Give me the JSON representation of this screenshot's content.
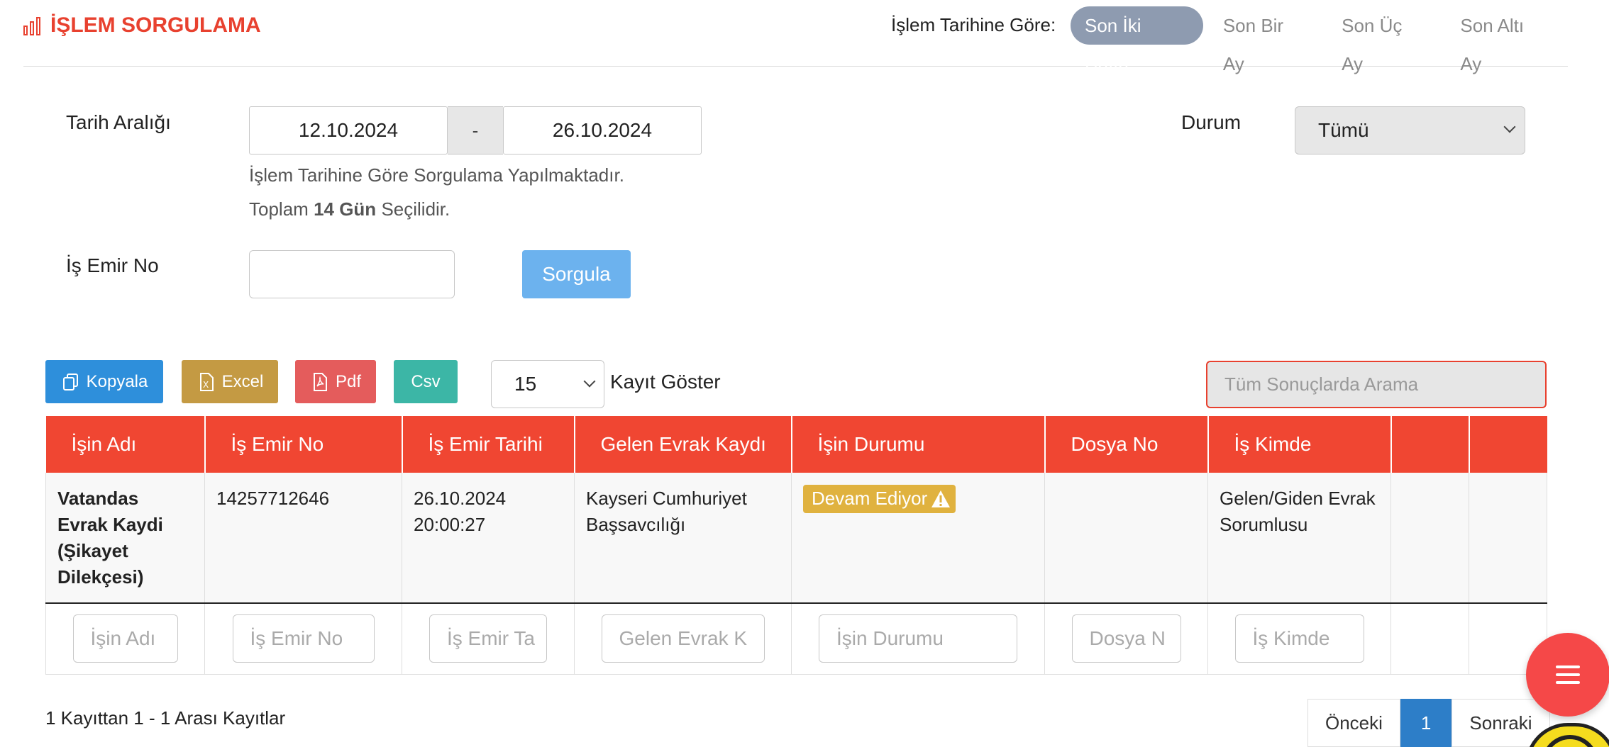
{
  "header": {
    "title": "İŞLEM SORGULAMA",
    "period_label": "İşlem Tarihine Göre:",
    "period_tabs": [
      {
        "label": "Son İki Hafta",
        "active": true
      },
      {
        "label": "Son Bir Ay",
        "active": false
      },
      {
        "label": "Son Üç Ay",
        "active": false
      },
      {
        "label": "Son Altı Ay",
        "active": false
      }
    ]
  },
  "form": {
    "date_range_label": "Tarih Aralığı",
    "date_from": "12.10.2024",
    "date_separator": "-",
    "date_to": "26.10.2024",
    "hint_line1": "İşlem Tarihine Göre Sorgulama Yapılmaktadır.",
    "hint_total_prefix": "Toplam",
    "hint_total_bold": "14 Gün",
    "hint_total_suffix": "Seçilidir.",
    "status_label": "Durum",
    "status_value": "Tümü",
    "order_no_label": "İş Emir No",
    "order_no_value": "",
    "query_button": "Sorgula"
  },
  "toolbar": {
    "copy": "Kopyala",
    "excel": "Excel",
    "pdf": "Pdf",
    "csv": "Csv",
    "page_length": "15",
    "page_length_label": "Kayıt Göster",
    "search_placeholder": "Tüm Sonuçlarda Arama",
    "colors": {
      "copy": "#2e8fdb",
      "excel": "#c49a43",
      "pdf": "#e45c5c",
      "csv": "#3cb6a6"
    }
  },
  "table": {
    "columns": [
      "İşin Adı",
      "İş Emir No",
      "İş Emir Tarihi",
      "Gelen Evrak Kaydı",
      "İşin Durumu",
      "Dosya No",
      "İş Kimde",
      "",
      ""
    ],
    "rows": [
      {
        "job_name": "Vatandas Evrak Kaydi (Şikayet Dilekçesi)",
        "order_no": "14257712646",
        "order_date": "26.10.2024 20:00:27",
        "incoming_record": "Kayseri Cumhuriyet Başsavcılığı",
        "status": "Devam Ediyor",
        "file_no": "",
        "assignee": "Gelen/Giden Evrak Sorumlusu"
      }
    ],
    "filters": [
      "İşin Adı",
      "İş Emir No",
      "İş Emir Ta",
      "Gelen Evrak K",
      "İşin Durumu",
      "Dosya N",
      "İş Kimde"
    ]
  },
  "footer": {
    "info": "1 Kayıttan 1 - 1 Arası Kayıtlar",
    "prev": "Önceki",
    "current_page": "1",
    "next": "Sonraki"
  },
  "colors": {
    "accent": "#e8412f",
    "header_bg": "#f04632",
    "badge": "#e0b23f",
    "active_tab": "#8e9bb0"
  }
}
